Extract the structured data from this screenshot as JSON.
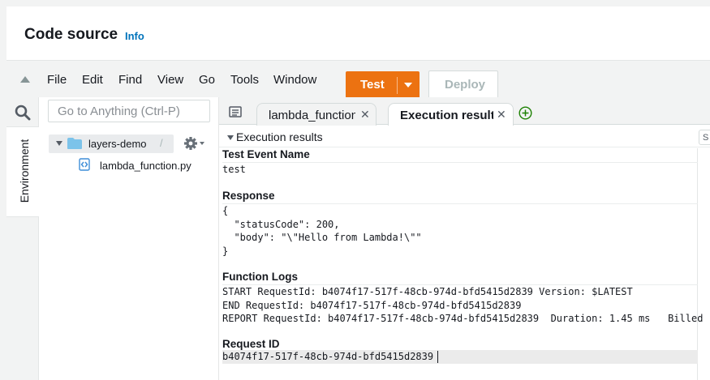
{
  "header": {
    "title": "Code source",
    "info": "Info"
  },
  "menubar": {
    "items": [
      "File",
      "Edit",
      "Find",
      "View",
      "Go",
      "Tools",
      "Window"
    ],
    "test_label": "Test",
    "deploy_label": "Deploy"
  },
  "sidebar": {
    "environment_label": "Environment"
  },
  "explorer": {
    "search_placeholder": "Go to Anything (Ctrl-P)",
    "folder": "layers-demo",
    "folder_suffix": "/",
    "file": "lambda_function.py"
  },
  "tabs": [
    {
      "label": "lambda_function"
    },
    {
      "label": "Execution results"
    }
  ],
  "results": {
    "title": "Execution results",
    "status_text": "S",
    "test_event_label": "Test Event Name",
    "test_event_value": "test",
    "response_label": "Response",
    "response_lines": [
      "{",
      "  \"statusCode\": 200,",
      "  \"body\": \"\\\"Hello from Lambda!\\\"\"",
      "}"
    ],
    "logs_label": "Function Logs",
    "log_lines": [
      "START RequestId: b4074f17-517f-48cb-974d-bfd5415d2839 Version: $LATEST",
      "END RequestId: b4074f17-517f-48cb-974d-bfd5415d2839",
      "REPORT RequestId: b4074f17-517f-48cb-974d-bfd5415d2839  Duration: 1.45 ms   Billed"
    ],
    "request_id_label": "Request ID",
    "request_id_value": "b4074f17-517f-48cb-974d-bfd5415d2839"
  },
  "colors": {
    "accent": "#ec7211",
    "link": "#0073bb"
  },
  "icons": [
    "collapse-up-icon",
    "search-icon",
    "folder-icon",
    "gear-icon",
    "python-file-icon",
    "tabs-menu-icon",
    "add-tab-icon",
    "close-icon"
  ]
}
